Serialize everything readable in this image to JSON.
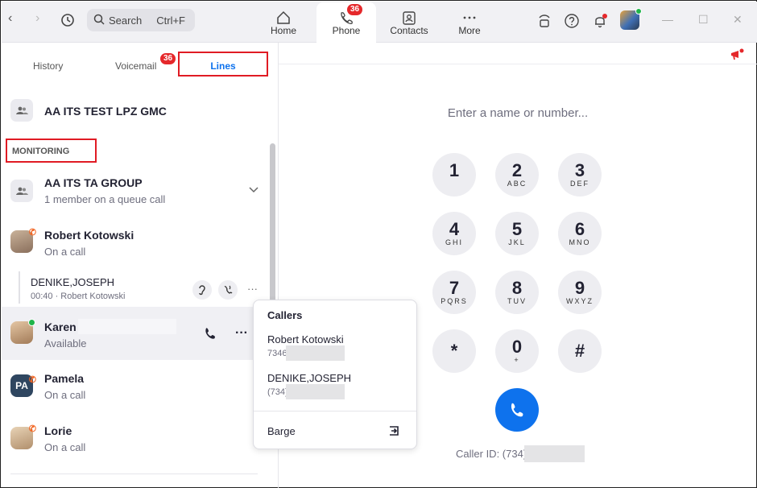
{
  "topbar": {
    "search_label": "Search",
    "search_shortcut": "Ctrl+F",
    "tabs": [
      {
        "label": "Home",
        "icon": "home-icon"
      },
      {
        "label": "Phone",
        "icon": "phone-icon",
        "badge": "36",
        "active": true
      },
      {
        "label": "Contacts",
        "icon": "contacts-icon"
      },
      {
        "label": "More",
        "icon": "more-icon"
      }
    ]
  },
  "subtabs": {
    "history": "History",
    "voicemail": "Voicemail",
    "voicemail_badge": "36",
    "lines": "Lines"
  },
  "lines": {
    "own_line": "AA ITS TEST LPZ GMC",
    "monitoring_header": "MONITORING",
    "group": {
      "name": "AA ITS TA GROUP",
      "status": "1 member on a queue call"
    },
    "contacts": [
      {
        "name": "Robert Kotowski",
        "status": "On a call"
      },
      {
        "name": "Karen",
        "status": "Available"
      },
      {
        "name": "Pamela",
        "status": "On a call",
        "initials": "PA"
      },
      {
        "name": "Lorie",
        "status": "On a call"
      }
    ],
    "active_call": {
      "name": "DENIKE,JOSEPH",
      "detail": "00:40 · Robert Kotowski"
    }
  },
  "popup": {
    "title": "Callers",
    "callers": [
      {
        "name": "Robert Kotowski",
        "number": "7346"
      },
      {
        "name": "DENIKE,JOSEPH",
        "number": "(734)"
      }
    ],
    "barge_label": "Barge"
  },
  "dialer": {
    "placeholder": "Enter a name or number...",
    "keys": [
      {
        "digit": "1",
        "letters": ""
      },
      {
        "digit": "2",
        "letters": "ABC"
      },
      {
        "digit": "3",
        "letters": "DEF"
      },
      {
        "digit": "4",
        "letters": "GHI"
      },
      {
        "digit": "5",
        "letters": "JKL"
      },
      {
        "digit": "6",
        "letters": "MNO"
      },
      {
        "digit": "7",
        "letters": "PQRS"
      },
      {
        "digit": "8",
        "letters": "TUV"
      },
      {
        "digit": "9",
        "letters": "WXYZ"
      },
      {
        "digit": "*",
        "letters": ""
      },
      {
        "digit": "0",
        "letters": "+"
      },
      {
        "digit": "#",
        "letters": ""
      }
    ],
    "caller_id_label": "Caller ID: (734)"
  },
  "colors": {
    "accent": "#0e72ed",
    "badge": "#e5282b",
    "highlight_box": "#e01b24",
    "available": "#1fb44a",
    "busy": "#f26522"
  }
}
